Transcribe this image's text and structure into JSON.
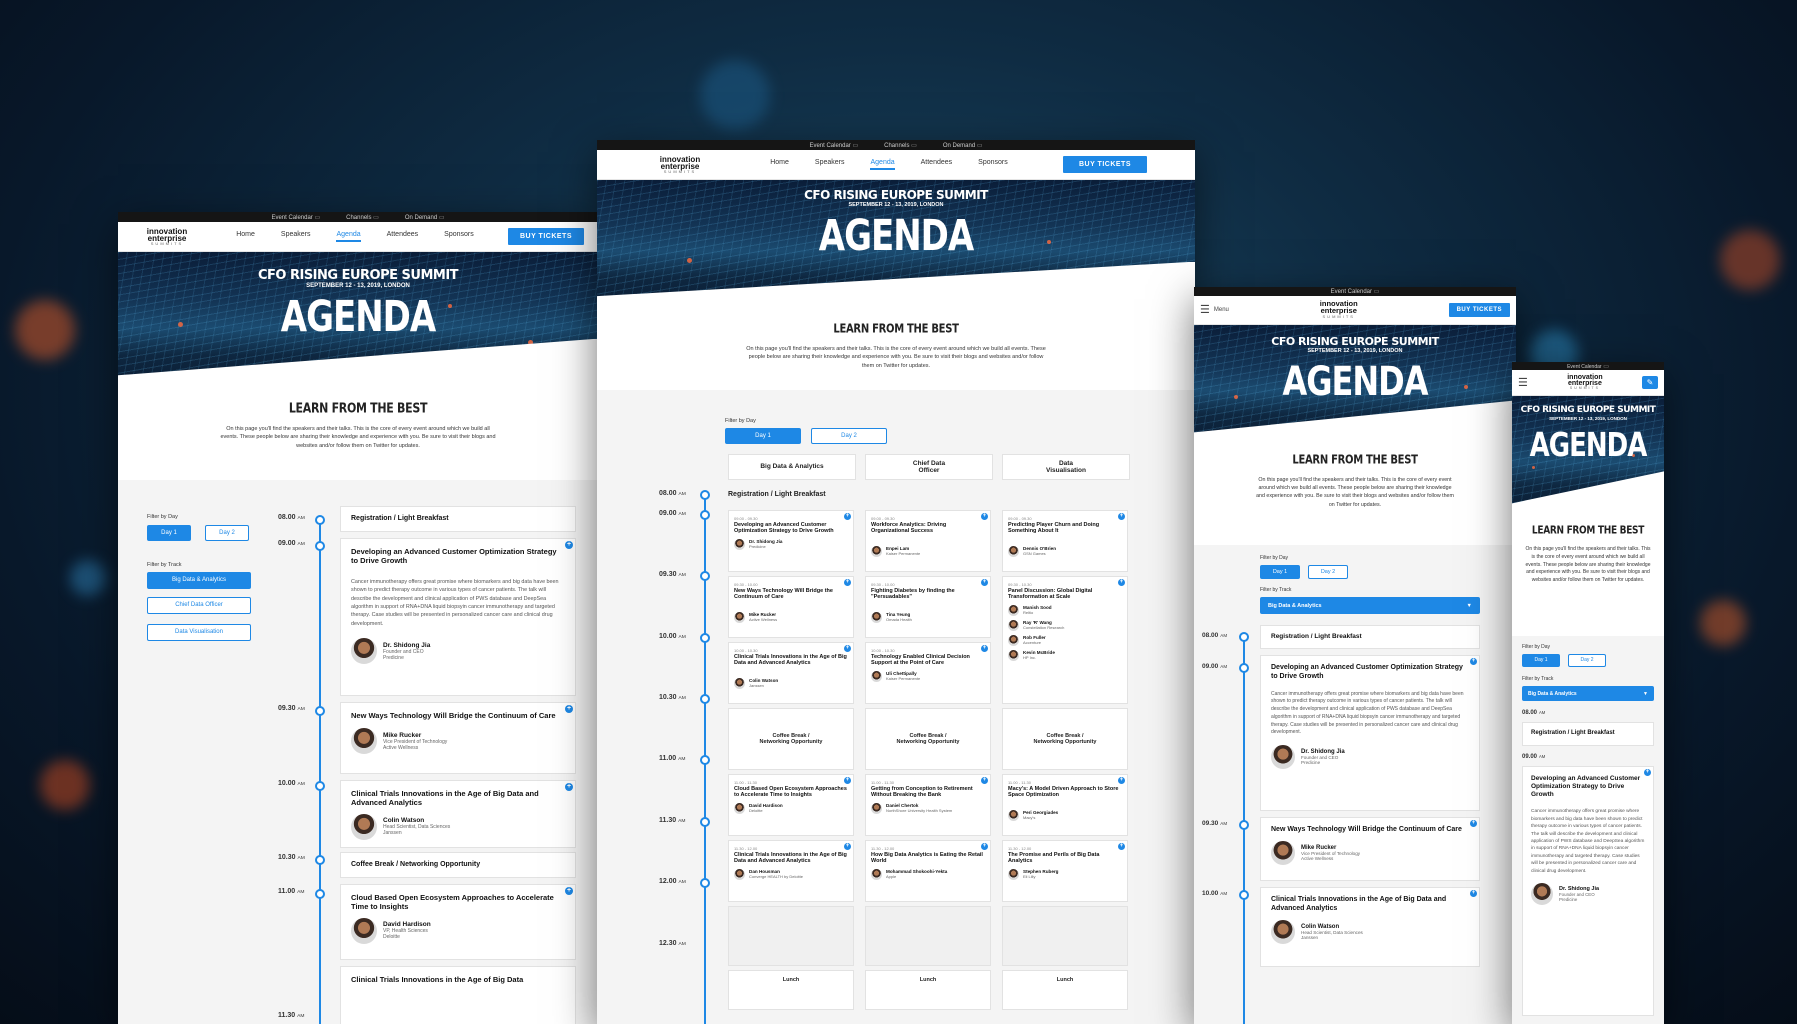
{
  "brand": {
    "line1": "innovation",
    "line2": "enterprise",
    "line3": "SUMMITS"
  },
  "topbar": {
    "calendar": "Event Calendar",
    "channels": "Channels",
    "ondemand": "On Demand"
  },
  "nav": {
    "home": "Home",
    "speakers": "Speakers",
    "agenda": "Agenda",
    "attendees": "Attendees",
    "sponsors": "Sponsors",
    "buy": "BUY TICKETS",
    "menu": "Menu"
  },
  "hero": {
    "event": "CFO RISING EUROPE SUMMIT",
    "date": "SEPTEMBER 12 - 13, 2019, LONDON",
    "title": "AGENDA"
  },
  "intro": {
    "heading": "LEARN FROM THE BEST",
    "body": "On this page you'll find the speakers and their talks. This is the core of every event around which we build all events. These people below are sharing their knowledge and experience with you. Be sure to visit their blogs and websites and/or follow them on Twitter for updates."
  },
  "filters": {
    "by_day": "Filter by Day",
    "day1": "Day 1",
    "day2": "Day 2",
    "by_track": "Filter by Track",
    "track1": "Big Data & Analytics",
    "track2": "Chief Data Officer",
    "track3": "Data Visualisation"
  },
  "columns": {
    "c1": "Big Data & Analytics",
    "c2": "Chief Data Officer",
    "c3": "Data Visualisation"
  },
  "ampm": "AM",
  "times": {
    "t0800": "08.00",
    "t0900": "09.00",
    "t0930": "09.30",
    "t1000": "10.00",
    "t1030": "10.30",
    "t1100": "11.00",
    "t1130": "11.30",
    "t1200": "12.00",
    "t1230": "12.30"
  },
  "sessions": {
    "breakfast": "Registration / Light Breakfast",
    "s1": {
      "title": "Developing an Advanced Customer Optimization Strategy to Drive Growth",
      "desc": "Cancer immunotherapy offers great promise where biomarkers and big data have been shown to predict therapy outcome in various types of cancer patients. The talk will describe the development and clinical application of PWS database and DeepSea algorithm in support of RNA+DNA liquid biopsyin cancer immunotherapy and targeted therapy. Case studies will be presented in personalized cancer care and clinical drug development.",
      "name": "Dr. Shidong Jia",
      "role": "Founder and CEO",
      "org": "Predicine"
    },
    "s2": {
      "title": "New Ways Technology Will Bridge the Continuum of Care",
      "name": "Mike Rucker",
      "role": "Vice President of Technology",
      "org": "Active Wellness"
    },
    "s3": {
      "title": "Clinical Trials Innovations in the Age of Big Data and Advanced Analytics",
      "name": "Colin Watson",
      "role": "Head Scientist, Data Sciences",
      "org": "Janssen"
    },
    "coffee": "Coffee Break / Networking Opportunity",
    "coffee_short": "Coffee Break / Networking Opportunity",
    "s4": {
      "title": "Cloud Based Open Ecosystem Approaches to Accelerate Time to Insights",
      "name": "David Hardison",
      "role": "VP, Health Sciences",
      "org": "Deloitte"
    },
    "s5_title": "Clinical Trials Innovations in the Age of Big Data"
  },
  "grid": {
    "r1": [
      {
        "time": "09.00 - 09.30",
        "title": "Developing an Advanced Customer Optimization Strategy to Drive Growth",
        "name": "Dr. Shidong Jia",
        "org": "Predicine"
      },
      {
        "time": "09.00 - 09.30",
        "title": "Workforce Analytics: Driving Organizational Success",
        "name": "Enpei Lam",
        "org": "Kaiser Permanente"
      },
      {
        "time": "09.00 - 09.30",
        "title": "Predicting Player Churn and Doing Something About It",
        "name": "Dennis O'Brien",
        "org": "GSN Games"
      }
    ],
    "r2": [
      {
        "time": "09.30 - 10.00",
        "title": "New Ways Technology Will Bridge the Continuum of Care",
        "name": "Mike Rucker",
        "org": "Active Wellness"
      },
      {
        "time": "09.30 - 10.00",
        "title": "Fighting Diabetes by finding the \"Persuadables\"",
        "name": "Tina Yeung",
        "org": "Omada Health"
      },
      {
        "time": "09.30 - 10.30",
        "title": "Panel Discussion: Global Digital Transformation at Scale",
        "p1": "Manish Sood",
        "p1o": "Reltio",
        "p2": "Ray 'R' Wang",
        "p2o": "Constellation Research",
        "p3": "Rob Fuller",
        "p3o": "Accenture",
        "p4": "Kevin McBride",
        "p4o": "HP Inc."
      }
    ],
    "r3": [
      {
        "time": "10.00 - 10.30",
        "title": "Clinical Trials Innovations in the Age of Big Data and Advanced Analytics",
        "name": "Colin Watson",
        "org": "Janssen"
      },
      {
        "time": "10.00 - 10.30",
        "title": "Technology Enabled Clinical Decision Support at the Point of Care",
        "name": "Uli Chettipally",
        "org": "Kaiser Permanente"
      }
    ],
    "r4": [
      {
        "time": "11.00 - 11.30",
        "title": "Cloud Based Open Ecosystem Approaches to Accelerate Time to Insights",
        "name": "David Hardison",
        "org": "Deloitte"
      },
      {
        "time": "11.00 - 11.30",
        "title": "Getting from Conception to Retirement Without Breaking the Bank",
        "name": "Daniel Chertok",
        "org": "NorthShore University Health System"
      },
      {
        "time": "11.00 - 11.30",
        "title": "Macy's: A Model Driven Approach to Store Space Optimization",
        "name": "Peri Georgiades",
        "org": "Macy's"
      }
    ],
    "r5": [
      {
        "time": "11.30 - 12.00",
        "title": "Clinical Trials Innovations in the Age of Big Data and Advanced Analytics",
        "name": "Dan Housman",
        "org": "Converge HEALTH by Deloitte"
      },
      {
        "time": "11.30 - 12.00",
        "title": "How Big Data Analytics is Eating the Retail World",
        "name": "Mohammad Shokoohi-Yekta",
        "org": "Apple"
      },
      {
        "time": "11.30 - 12.00",
        "title": "The Promise and Perils of Big Data Analytics",
        "name": "Stephen Ruberg",
        "org": "Eli Lilly"
      }
    ],
    "lunch": "Lunch"
  },
  "colors": {
    "accent": "#1e88e5",
    "bg_dark": "#08182a"
  }
}
